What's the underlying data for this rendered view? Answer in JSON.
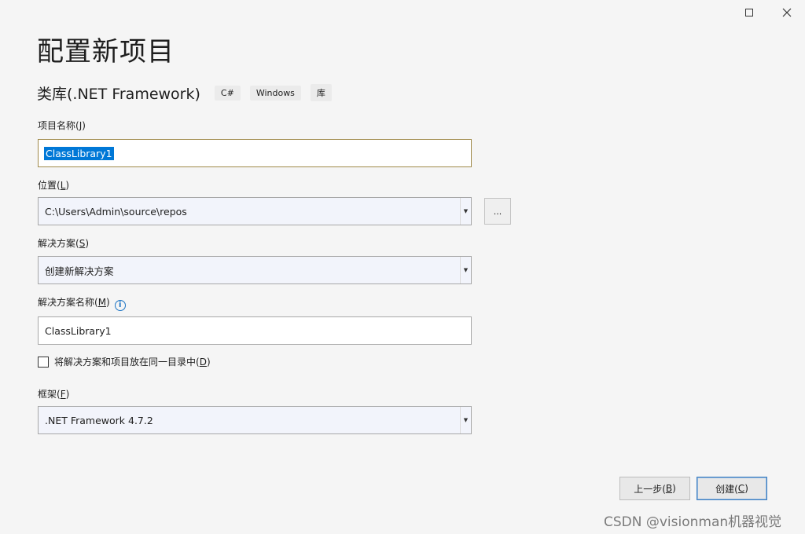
{
  "window": {
    "maximize_glyph": "maximize-icon",
    "close_glyph": "close-icon"
  },
  "page": {
    "title": "配置新项目",
    "subtitle": "类库(.NET Framework)",
    "tags": [
      "C#",
      "Windows",
      "库"
    ]
  },
  "project_name": {
    "label": "项目名称(",
    "key": "J",
    "label_end": ")",
    "value": "ClassLibrary1"
  },
  "location": {
    "label": "位置(",
    "key": "L",
    "label_end": ")",
    "value": "C:\\Users\\Admin\\source\\repos",
    "browse_label": "..."
  },
  "solution": {
    "label": "解决方案(",
    "key": "S",
    "label_end": ")",
    "value": "创建新解决方案"
  },
  "solution_name": {
    "label": "解决方案名称(",
    "key": "M",
    "label_end": ")",
    "value": "ClassLibrary1",
    "info_glyph": "i"
  },
  "same_dir": {
    "label": "将解决方案和项目放在同一目录中(",
    "key": "D",
    "label_end": ")",
    "checked": false
  },
  "framework": {
    "label": "框架(",
    "key": "F",
    "label_end": ")",
    "value": ".NET Framework 4.7.2"
  },
  "buttons": {
    "back": {
      "label": "上一步(",
      "key": "B",
      "end": ")"
    },
    "create": {
      "label": "创建(",
      "key": "C",
      "end": ")"
    }
  },
  "watermark": "CSDN @visionman机器视觉"
}
